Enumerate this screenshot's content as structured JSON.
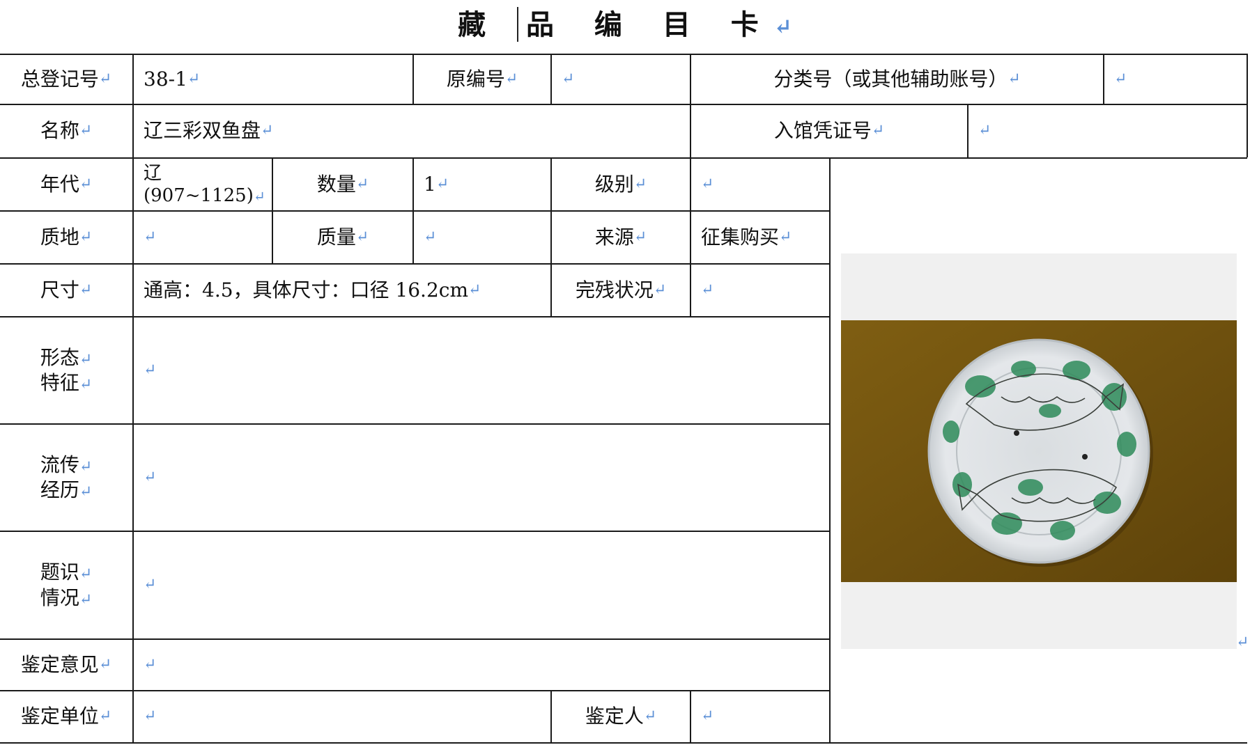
{
  "title": "藏 品 编 目 卡",
  "return_mark": "↵",
  "card": {
    "registration_no": {
      "label": "总登记号",
      "value": "38-1"
    },
    "original_no": {
      "label": "原编号",
      "value": ""
    },
    "classification_no": {
      "label": "分类号（或其他辅助账号）",
      "value": ""
    },
    "name": {
      "label": "名称",
      "value": "辽三彩双鱼盘"
    },
    "voucher_no": {
      "label": "入馆凭证号",
      "value": ""
    },
    "era": {
      "label": "年代",
      "value_line1": "辽",
      "value_line2": "(907~1125)"
    },
    "quantity": {
      "label": "数量",
      "value": "1"
    },
    "grade": {
      "label": "级别",
      "value": ""
    },
    "material": {
      "label": "质地",
      "value": ""
    },
    "mass": {
      "label": "质量",
      "value": ""
    },
    "source": {
      "label": "来源",
      "value": "征集购买"
    },
    "size": {
      "label": "尺寸",
      "value": "通高：4.5，具体尺寸：口径 16.2cm"
    },
    "condition": {
      "label": "完残状况",
      "value": ""
    },
    "form": {
      "label_line1": "形态",
      "label_line2": "特征",
      "value": ""
    },
    "provenance": {
      "label_line1": "流传",
      "label_line2": "经历",
      "value": ""
    },
    "inscription": {
      "label_line1": "题识",
      "label_line2": "情况",
      "value": ""
    },
    "appraisal_opinion": {
      "label": "鉴定意见",
      "value": ""
    },
    "appraisal_unit": {
      "label": "鉴定单位",
      "value": ""
    },
    "appraiser": {
      "label": "鉴定人",
      "value": ""
    }
  },
  "colors": {
    "border": "#1a1a1a",
    "return_mark": "#5b8fd6",
    "photo_background": "#f0f0f0",
    "table_surface": "#7a5a12",
    "plate_glaze": "#dfe3e6",
    "green_glaze": "#2e8b5a"
  }
}
